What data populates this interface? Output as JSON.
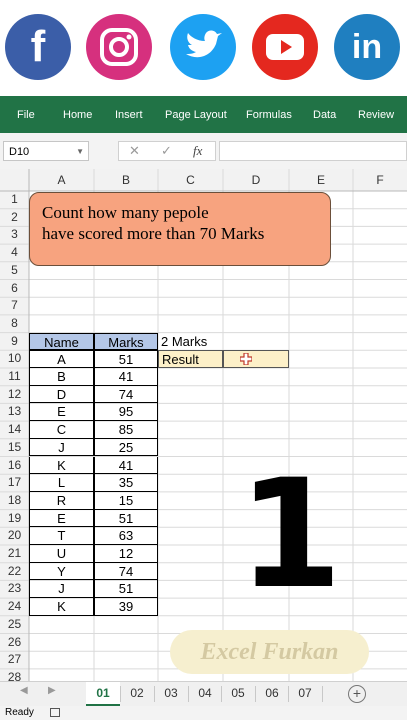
{
  "social": [
    {
      "name": "facebook",
      "icon": "facebook-icon",
      "glyph": "f",
      "color": "#3b5ea8"
    },
    {
      "name": "instagram",
      "icon": "instagram-icon",
      "glyph": "",
      "color": "#d6307e"
    },
    {
      "name": "twitter",
      "icon": "twitter-icon",
      "glyph": "",
      "color": "#1da1f2"
    },
    {
      "name": "youtube",
      "icon": "youtube-icon",
      "glyph": "",
      "color": "#e4281f"
    },
    {
      "name": "linkedin",
      "icon": "linkedin-icon",
      "glyph": "in",
      "color": "#1f7fc0"
    }
  ],
  "ribbon": {
    "color": "#217346",
    "tabs": [
      "File",
      "Home",
      "Insert",
      "Page Layout",
      "Formulas",
      "Data",
      "Review"
    ]
  },
  "formula_bar": {
    "name_box": "D10",
    "cancel_symbol": "✕",
    "enter_symbol": "✓",
    "fx_symbol": "fx",
    "formula": ""
  },
  "sheet": {
    "columns": [
      "A",
      "B",
      "C",
      "D",
      "E",
      "F"
    ],
    "rows": [
      "1",
      "2",
      "3",
      "4",
      "5",
      "6",
      "7",
      "8",
      "9",
      "10",
      "11",
      "12",
      "13",
      "14",
      "15",
      "16",
      "17",
      "18",
      "19",
      "20",
      "21",
      "22",
      "23",
      "24",
      "25",
      "26",
      "27",
      "28"
    ],
    "callout_text": "Count how many pepole\nhave scored more than 70 Marks",
    "header_name": "Name",
    "header_marks": "Marks",
    "label_c9": "2 Marks",
    "label_result": "Result",
    "students": [
      {
        "name": "A",
        "marks": "51"
      },
      {
        "name": "B",
        "marks": "41"
      },
      {
        "name": "D",
        "marks": "74"
      },
      {
        "name": "E",
        "marks": "95"
      },
      {
        "name": "C",
        "marks": "85"
      },
      {
        "name": "J",
        "marks": "25"
      },
      {
        "name": "K",
        "marks": "41"
      },
      {
        "name": "L",
        "marks": "35"
      },
      {
        "name": "R",
        "marks": "15"
      },
      {
        "name": "E",
        "marks": "51"
      },
      {
        "name": "T",
        "marks": "63"
      },
      {
        "name": "U",
        "marks": "12"
      },
      {
        "name": "Y",
        "marks": "74"
      },
      {
        "name": "J",
        "marks": "51"
      },
      {
        "name": "K",
        "marks": "39"
      }
    ],
    "header_fill": "#b4c7e7",
    "result_fill": "#fdf0c8",
    "callout_fill": "#f7a37f",
    "big_number": "1",
    "watermark": "Excel Furkan"
  },
  "tabs": {
    "sheets": [
      "01",
      "02",
      "03",
      "04",
      "05",
      "06",
      "07"
    ],
    "active": "01"
  },
  "status": {
    "ready": "Ready"
  }
}
